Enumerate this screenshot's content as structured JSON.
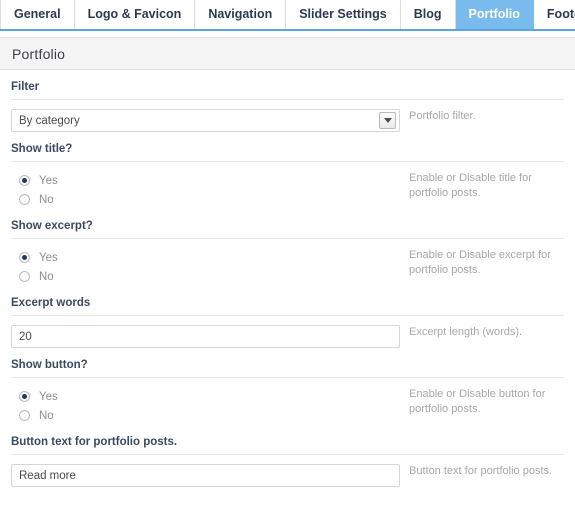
{
  "tabs": [
    {
      "label": "General",
      "active": false
    },
    {
      "label": "Logo & Favicon",
      "active": false
    },
    {
      "label": "Navigation",
      "active": false
    },
    {
      "label": "Slider Settings",
      "active": false
    },
    {
      "label": "Blog",
      "active": false
    },
    {
      "label": "Portfolio",
      "active": true
    },
    {
      "label": "Footer",
      "active": false
    }
  ],
  "panel": {
    "title": "Portfolio",
    "accent_color": "#79bbec",
    "header_bg": "#f5f5f5"
  },
  "fields": {
    "filter": {
      "label": "Filter",
      "type": "select",
      "value": "By category",
      "description": "Portfolio filter.",
      "arrow_icon": "chevron-down-icon"
    },
    "show_title": {
      "label": "Show title?",
      "type": "radio",
      "options": [
        {
          "label": "Yes",
          "checked": true
        },
        {
          "label": "No",
          "checked": false
        }
      ],
      "description": "Enable or Disable title for portfolio posts."
    },
    "show_excerpt": {
      "label": "Show excerpt?",
      "type": "radio",
      "options": [
        {
          "label": "Yes",
          "checked": true
        },
        {
          "label": "No",
          "checked": false
        }
      ],
      "description": "Enable or Disable excerpt for portfolio posts."
    },
    "excerpt_words": {
      "label": "Excerpt words",
      "type": "text",
      "value": "20",
      "placeholder": "",
      "description": "Excerpt length (words)."
    },
    "show_button": {
      "label": "Show button?",
      "type": "radio",
      "options": [
        {
          "label": "Yes",
          "checked": true
        },
        {
          "label": "No",
          "checked": false
        }
      ],
      "description": "Enable or Disable button for portfolio posts."
    },
    "button_text": {
      "label": "Button text for portfolio posts.",
      "type": "text",
      "value": "Read more",
      "placeholder": "",
      "description": "Button text for portfolio posts."
    }
  }
}
